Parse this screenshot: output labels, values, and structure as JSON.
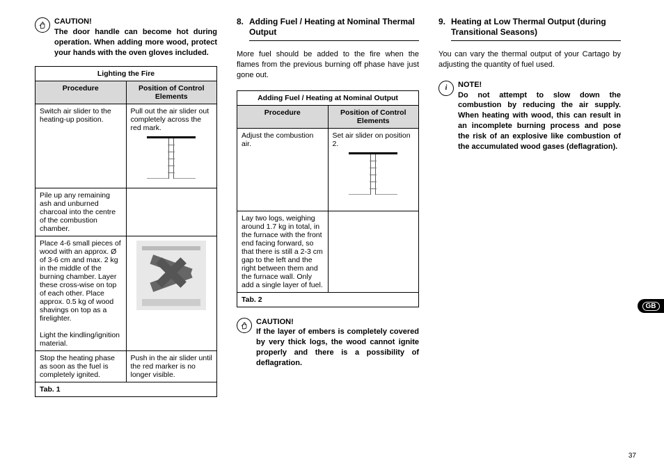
{
  "page_number": "37",
  "lang_tab": "GB",
  "col1": {
    "caution_title": "CAUTION!",
    "caution_body": "The door handle can become hot during operation. When adding more wood, protect your hands with the oven gloves included.",
    "table": {
      "title": "Lighting the Fire",
      "h1": "Procedure",
      "h2": "Position of Control Elements",
      "r1c1": "Switch air slider to the heating-up position.",
      "r1c2": "Pull out the air slider out completely across the red mark.",
      "r2c1": "Pile up any remaining ash and unburned charcoal into the centre of the combustion chamber.",
      "r3c1a": "Place 4-6 small pieces of wood with an approx. Ø of 3-6 cm and max. 2 kg in the middle of the burning chamber. Layer these cross-wise on top of each other. Place approx. 0.5 kg of wood shavings on top as a firelighter.",
      "r3c1b": "Light the kindling/ignition material.",
      "r4c1": "Stop the heating phase as soon as the fuel is completely ignited.",
      "r4c2": "Push in the air slider until the red marker is no longer visible.",
      "caption": "Tab. 1"
    }
  },
  "col2": {
    "sec_num": "8.",
    "sec_title": "Adding Fuel / Heating at Nominal Thermal Output",
    "intro": "More fuel should be added to the fire when the flames from the previous burning off phase have just gone out.",
    "table": {
      "title": "Adding Fuel / Heating at Nominal Output",
      "h1": "Procedure",
      "h2": "Position of Control Elements",
      "r1c1": "Adjust the combustion air.",
      "r1c2": "Set air slider on position 2.",
      "r2c1": "Lay two logs, weighing around 1.7 kg in total, in the furnace with the front end facing forward, so that there is still a 2-3 cm gap to the left and the right between them and the furnace wall. Only add a single layer of fuel.",
      "caption": "Tab. 2"
    },
    "caution_title": "CAUTION!",
    "caution_body": "If the layer of embers is completely covered by very thick logs, the wood cannot ignite properly and there is a possibility of deflagration."
  },
  "col3": {
    "sec_num": "9.",
    "sec_title": "Heating at Low Thermal Output (during Transitional Seasons)",
    "intro": "You can vary the thermal output of your Cartago by adjusting the quantity of fuel used.",
    "note_title": "NOTE!",
    "note_body": "Do not attempt to slow down the combustion by reducing the air supply. When heating with wood, this can result in an incomplete burning process and pose the risk of an explosive like combustion of the accumulated wood gases (deflagration)."
  }
}
